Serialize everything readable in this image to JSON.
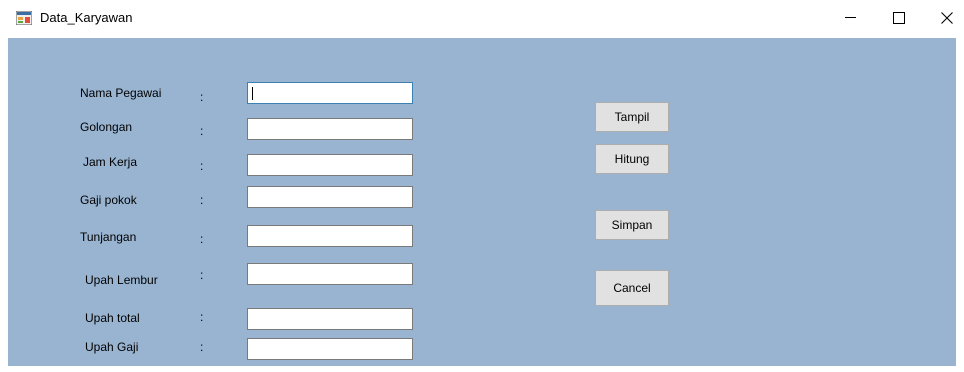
{
  "window": {
    "title": "Data_Karyawan",
    "icon": "form-app-icon",
    "controls": {
      "minimize": "minimize-icon",
      "maximize": "maximize-icon",
      "close": "close-icon"
    }
  },
  "colors": {
    "client_background": "#99b4d1",
    "button_face": "#e1e1e1"
  },
  "form": {
    "colon": ":",
    "fields": [
      {
        "label": "Nama Pegawai",
        "value": ""
      },
      {
        "label": "Golongan",
        "value": ""
      },
      {
        "label": "Jam Kerja",
        "value": ""
      },
      {
        "label": "Gaji pokok",
        "value": ""
      },
      {
        "label": "Tunjangan",
        "value": ""
      },
      {
        "label": "Upah Lembur",
        "value": ""
      },
      {
        "label": "Upah total",
        "value": ""
      },
      {
        "label": "Upah Gaji",
        "value": ""
      }
    ],
    "buttons": {
      "tampil": "Tampil",
      "hitung": "Hitung",
      "simpan": "Simpan",
      "cancel": "Cancel"
    }
  }
}
